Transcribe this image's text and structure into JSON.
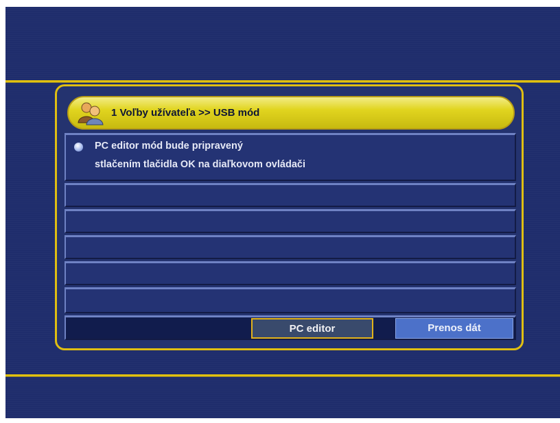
{
  "dialog": {
    "title": "1  Voľby užívateľa >> USB mód",
    "title_icon": "users-icon",
    "message_lines": [
      "PC editor mód bude pripravený",
      "stlačením tlačidla OK na diaľkovom ovládači"
    ],
    "bullet_icon": "bullet-icon",
    "buttons": {
      "pc_editor": "PC editor",
      "transfer": "Prenos dát"
    }
  },
  "colors": {
    "background": "#1f2d6c",
    "accent": "#e0bf12",
    "title_bar": "#e1d51f",
    "selected_button": "#394a6c",
    "secondary_button": "#4c71c9"
  }
}
